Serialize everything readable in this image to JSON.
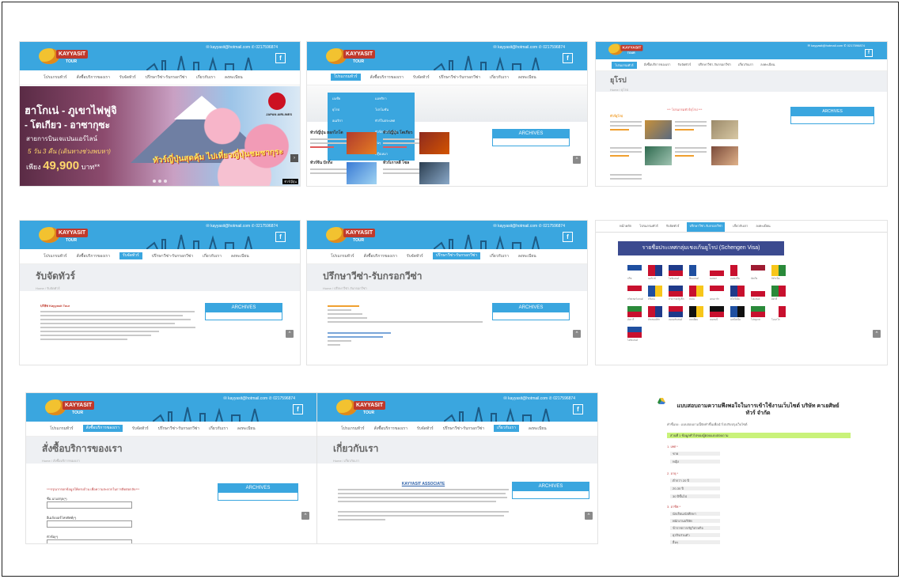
{
  "site": {
    "brand": "KAYYASIT",
    "brand_sub": "TOUR",
    "email": "kayyasit@hotmail.com",
    "phone": "0217596874",
    "fb": "f"
  },
  "menu": [
    "โปรแกรมทัวร์",
    "สั่งซื้อบริการของเรา",
    "รับจัดทัวร์",
    "ปรึกษาวีซ่า-รับกรอกวีซ่า",
    "เกี่ยวกับเรา",
    "ลงทะเบียน"
  ],
  "archives_label": "ARCHIVES",
  "archives_label_alt": "ARCHIVES",
  "up_symbol": "^",
  "hero": {
    "line1": "ฮาโกเน่ - ภูเขาไฟฟูจิ",
    "line2": "- โตเกียว - อาซากุซะ",
    "line3": "สายการบินเจแปนแอร์ไลน์",
    "line4": "5 วัน 3 คืน (เดินทางช่วงพบหา)",
    "price_prefix": "เพียง",
    "price": "49,900",
    "price_suffix": "บาท**",
    "promo": "ทัวร์ญี่ปุ่นสุดคุ้ม ไปเที่ยวญี่ปุ่นชมซากุระ",
    "airline": "JAPAN AIRLINES",
    "caption": "ทัวร์ญี่ปุ่น",
    "next": "›"
  },
  "thumb2": {
    "dropdown_items": [
      "เอเชีย",
      "ยุโรป",
      "อเมริกา",
      "แอฟริกา",
      "โปรโมชั่น",
      "ทัวร์ในประเทศ",
      "ทัวร์ต่างประเทศ",
      "อื่นๆ",
      "กรุ๊ปเหมา"
    ],
    "cards": [
      "ทัวร์ญี่ปุ่น ฮอกไกโด",
      "ทัวร์ญี่ปุ่น โตเกียว",
      "ทัวร์จีน ปักกิ่ง",
      "ทัวร์เกาหลี โซล"
    ],
    "archives": "ARCHIVES"
  },
  "thumb3": {
    "title": "ยุโรป",
    "bc": "Home / ยุโรป",
    "promo": "*** โปรแกรมทัวร์ยุโรป ***",
    "section": "ทัวร์ยุโรป"
  },
  "thumb4": {
    "title": "รับจัดทัวร์",
    "bc": "Home / รับจัดทัวร์",
    "intro": "บริษัท Kayyasit Tour"
  },
  "thumb5": {
    "title": "ปรึกษาวีซ่า-รับกรอกวีซ่า",
    "bc": "Home / ปรึกษาวีซ่า-รับกรอกวีซ่า"
  },
  "thumb6": {
    "menu": [
      "หน้าหลัก",
      "โปรแกรมทัวร์",
      "รับจัดทัวร์",
      "ปรึกษาวีซ่า-รับกรอกวีซ่า",
      "เกี่ยวกับเรา",
      "ลงทะเบียน"
    ],
    "flag_title": "รายชื่อประเทศกลุ่มเชงเก้นยูโรป (Schengen Visa)",
    "flags": [
      {
        "c1": "#1f4fa0",
        "c2": "#ffffff"
      },
      {
        "c1": "#c8102e",
        "c2": "#1f3a8a"
      },
      {
        "c1": "#1f3a8a",
        "c2": "#c8102e"
      },
      {
        "c1": "#1f4fa0",
        "c2": "#ffffff"
      },
      {
        "c1": "#ffffff",
        "c2": "#c8102e"
      },
      {
        "c1": "#c8102e",
        "c2": "#ffffff"
      },
      {
        "c1": "#9e1b32",
        "c2": "#ffffff"
      },
      {
        "c1": "#f7c61a",
        "c2": "#2a8a3a"
      },
      {
        "c1": "#c8102e",
        "c2": "#ffffff"
      },
      {
        "c1": "#1f4fa0",
        "c2": "#f7c61a"
      },
      {
        "c1": "#1f3a8a",
        "c2": "#c8102e"
      },
      {
        "c1": "#c8102e",
        "c2": "#f7c61a"
      },
      {
        "c1": "#c8102e",
        "c2": "#ffffff"
      },
      {
        "c1": "#1f3a8a",
        "c2": "#c8102e"
      },
      {
        "c1": "#ffffff",
        "c2": "#c8102e"
      },
      {
        "c1": "#2a8a3a",
        "c2": "#c8102e"
      },
      {
        "c1": "#2a8a3a",
        "c2": "#c8102e"
      },
      {
        "c1": "#c8102e",
        "c2": "#1f3a8a"
      },
      {
        "c1": "#c8102e",
        "c2": "#1f3a8a"
      },
      {
        "c1": "#111111",
        "c2": "#f7c61a"
      },
      {
        "c1": "#111111",
        "c2": "#c8102e"
      },
      {
        "c1": "#1f4fa0",
        "c2": "#111111"
      },
      {
        "c1": "#2a8a3a",
        "c2": "#c8102e"
      },
      {
        "c1": "#ffffff",
        "c2": "#c8102e"
      },
      {
        "c1": "#1f4fa0",
        "c2": "#c8102e"
      }
    ],
    "flag_names": [
      "กรีซ",
      "นอร์เวย์",
      "ไอซ์แลนด์",
      "ฟินแลนด์",
      "มอลตา",
      "ออสเตรีย",
      "ลัตเวีย",
      "ลิทัวเนีย",
      "สวิตเซอร์แลนด์",
      "สวีเดน",
      "สาธารณรัฐเช็ก",
      "สเปน",
      "เดนมาร์ก",
      "สโลวีเนีย",
      "โปแลนด์",
      "อิตาลี",
      "ฮังการี",
      "ลักเซมเบิร์ก",
      "เนเธอร์แลนด์",
      "เบลเยียม",
      "เยอรมนี",
      "เอสโตเนีย",
      "โปรตุเกส",
      "โมนาโก",
      "ไอซ์แลนด์"
    ]
  },
  "thumb7": {
    "title": "สั่งซื้อบริการของเรา",
    "bc": "Home / สั่งซื้อบริการของเรา",
    "note": "***กรุณากรอกข้อมูลให้ครบถ้วน เพื่อความสะดวกในการติดต่อกลับ***",
    "f1": "ชื่อ-นามสกุล(*)",
    "f2": "อีเมล์/เบอร์โทรศัพท์(*)",
    "f3": "หัวข้อ(*)"
  },
  "thumb8": {
    "title": "เกี่ยวกับเรา",
    "bc": "Home / เกี่ยวกับเรา",
    "company": "KAYYASIT ASSOCIATE",
    "archives": "ARCHIVES"
  },
  "thumb9": {
    "title": "แบบสอบถามความพึงพอใจในการเข้าใช้งานเว็บไซต์ บริษัท คาเยศิษย์ ทัวร์ จำกัด",
    "sub": "คำชี้แจง : แบบสอบถามนี้จัดทำขึ้นเพื่อนำไปปรับปรุงเว็บไซต์",
    "bar": "ส่วนที่ 1 ข้อมูลทั่วไปของผู้ตอบแบบสอบถาม",
    "q1": "1. เพศ *",
    "q1o": [
      "ชาย",
      "หญิง"
    ],
    "q2": "2. อายุ *",
    "q2o": [
      "ต่ำกว่า 20 ปี",
      "20-30 ปี",
      "30 ปีขึ้นไป"
    ],
    "q3": "3. อาชีพ *",
    "q3o": [
      "นักเรียน/นักศึกษา",
      "พนักงานบริษัท",
      "ข้าราชการ/รัฐวิสาหกิจ",
      "ธุรกิจส่วนตัว",
      "อื่นๆ"
    ]
  }
}
